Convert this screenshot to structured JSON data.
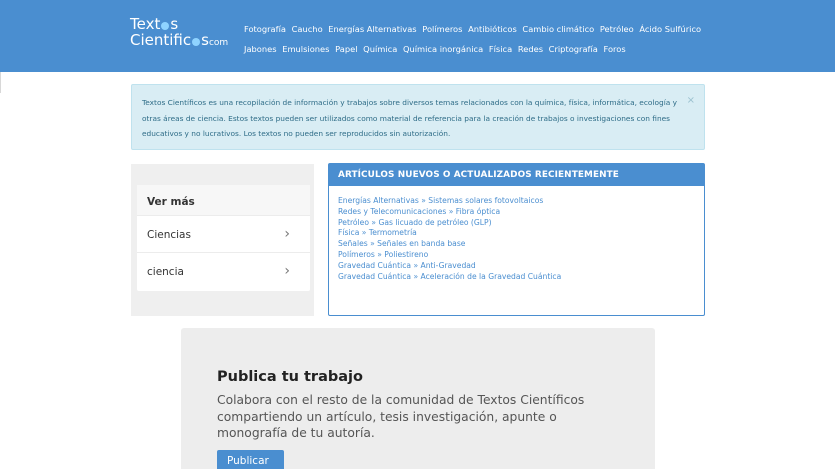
{
  "header": {
    "logo_line1_a": "Text",
    "logo_line1_b": "s",
    "logo_line2_a": "Cientific",
    "logo_line2_b": "s",
    "logo_suffix": "com",
    "nav_items": [
      "Fotografía",
      "Caucho",
      "Energías Alternativas",
      "Polímeros",
      "Antibióticos",
      "Cambio climático",
      "Petróleo",
      "Ácido Sulfúrico",
      "Jabones",
      "Emulsiones",
      "Papel",
      "Química",
      "Química inorgánica",
      "Física",
      "Redes",
      "Criptografía",
      "Foros"
    ]
  },
  "alert": {
    "text": "Textos Científicos es una recopilación de información y trabajos sobre diversos temas relacionados con la química, física, informática, ecología y otras áreas de ciencia. Estos textos pueden ser utilizados como material de referencia para la creación de trabajos o investigaciones con fines educativos y no lucrativos. Los textos no pueden ser reproducidos sin autorización.",
    "close": "×"
  },
  "see_more": {
    "title": "Ver más",
    "items": [
      "Ciencias",
      "ciencia"
    ],
    "chevron": "›"
  },
  "articles": {
    "heading": "ARTÍCULOS NUEVOS O ACTUALIZADOS RECIENTEMENTE",
    "items": [
      "Energías Alternativas » Sistemas solares fotovoltaicos",
      "Redes y Telecomunicaciones » Fibra óptica",
      "Petróleo » Gas licuado de petróleo (GLP)",
      "Física » Termometría",
      "Señales » Señales en banda base",
      "Polímeros » Poliestireno",
      "Gravedad Cuántica » Anti-Gravedad",
      "Gravedad Cuántica » Aceleración de la Gravedad Cuántica"
    ]
  },
  "publish": {
    "title": "Publica tu trabajo",
    "text": "Colabora con el resto de la comunidad de Textos Científicos compartiendo un artículo, tesis investigación, apunte o monografía de tu autoría.",
    "button": "Publicar"
  },
  "colors": {
    "brand": "#4a8ed0",
    "alert_bg": "#d9edf4",
    "alert_text": "#2e6c87"
  }
}
